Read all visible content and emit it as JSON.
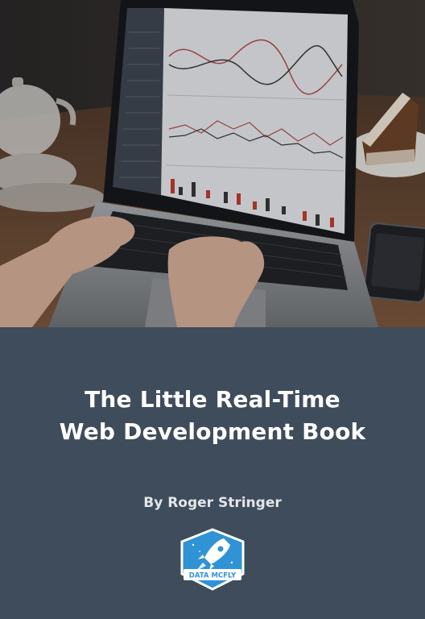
{
  "book": {
    "title_line_1": "The Little Real-Time",
    "title_line_2": "Web Development Book",
    "author": "By Roger Stringer"
  },
  "logo": {
    "text": "DATA MCFLY",
    "icon": "rocket-icon"
  },
  "colors": {
    "panel_background": "#3f4c5c",
    "title_text": "#ffffff",
    "author_text": "#e3e6ea",
    "logo_blue": "#2f93d6",
    "logo_border": "#ffffff"
  }
}
